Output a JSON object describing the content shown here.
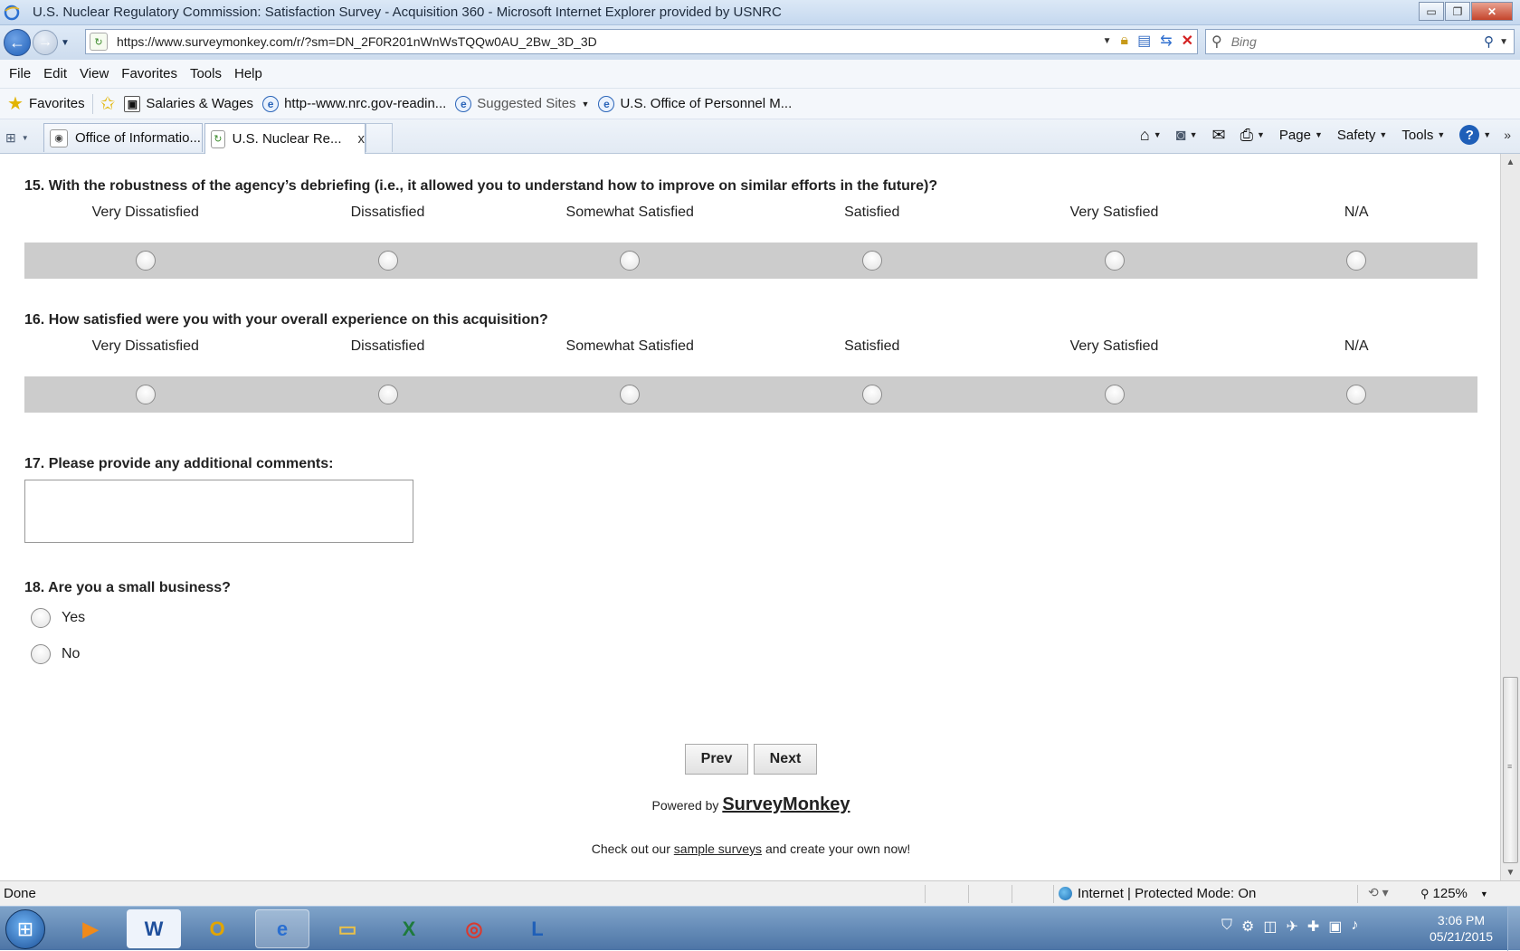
{
  "window": {
    "title": "U.S. Nuclear Regulatory Commission: Satisfaction Survey - Acquisition 360 - Microsoft Internet Explorer provided by USNRC",
    "minimize": "▭",
    "restore": "❐",
    "close": "✕"
  },
  "address": {
    "url": "https://www.surveymonkey.com/r/?sm=DN_2F0R201nWnWsTQQw0AU_2Bw_3D_3D",
    "search_placeholder": "Bing"
  },
  "menu": [
    "File",
    "Edit",
    "View",
    "Favorites",
    "Tools",
    "Help"
  ],
  "favorites": {
    "label": "Favorites",
    "links": [
      "Salaries & Wages",
      "http--www.nrc.gov-readin...",
      "Suggested Sites",
      "U.S. Office of Personnel M..."
    ]
  },
  "tabs": [
    {
      "label": "Office of Informatio..."
    },
    {
      "label": "U.S. Nuclear Re...",
      "close": "x"
    }
  ],
  "command_bar": {
    "page": "Page",
    "safety": "Safety",
    "tools": "Tools",
    "help": "?"
  },
  "survey": {
    "q15": "15. With the robustness of the agency’s debriefing (i.e., it allowed you to understand how to improve on similar efforts in the future)?",
    "q16": "16. How satisfied were you with your overall experience on this acquisition?",
    "q17": "17. Please provide any additional comments:",
    "q18": "18. Are you a small business?",
    "scale": [
      "Very Dissatisfied",
      "Dissatisfied",
      "Somewhat Satisfied",
      "Satisfied",
      "Very Satisfied",
      "N/A"
    ],
    "q18_options": [
      "Yes",
      "No"
    ],
    "prev": "Prev",
    "next": "Next",
    "powered_by": "Powered by",
    "brand": "SurveyMonkey",
    "checkout_pre": "Check out our",
    "checkout_link": "sample surveys",
    "checkout_post": "and create your own now!"
  },
  "status": {
    "text": "Done",
    "zone": "Internet | Protected Mode: On",
    "zoom": "125%"
  },
  "clock": {
    "time": "3:06 PM",
    "date": "05/21/2015"
  }
}
